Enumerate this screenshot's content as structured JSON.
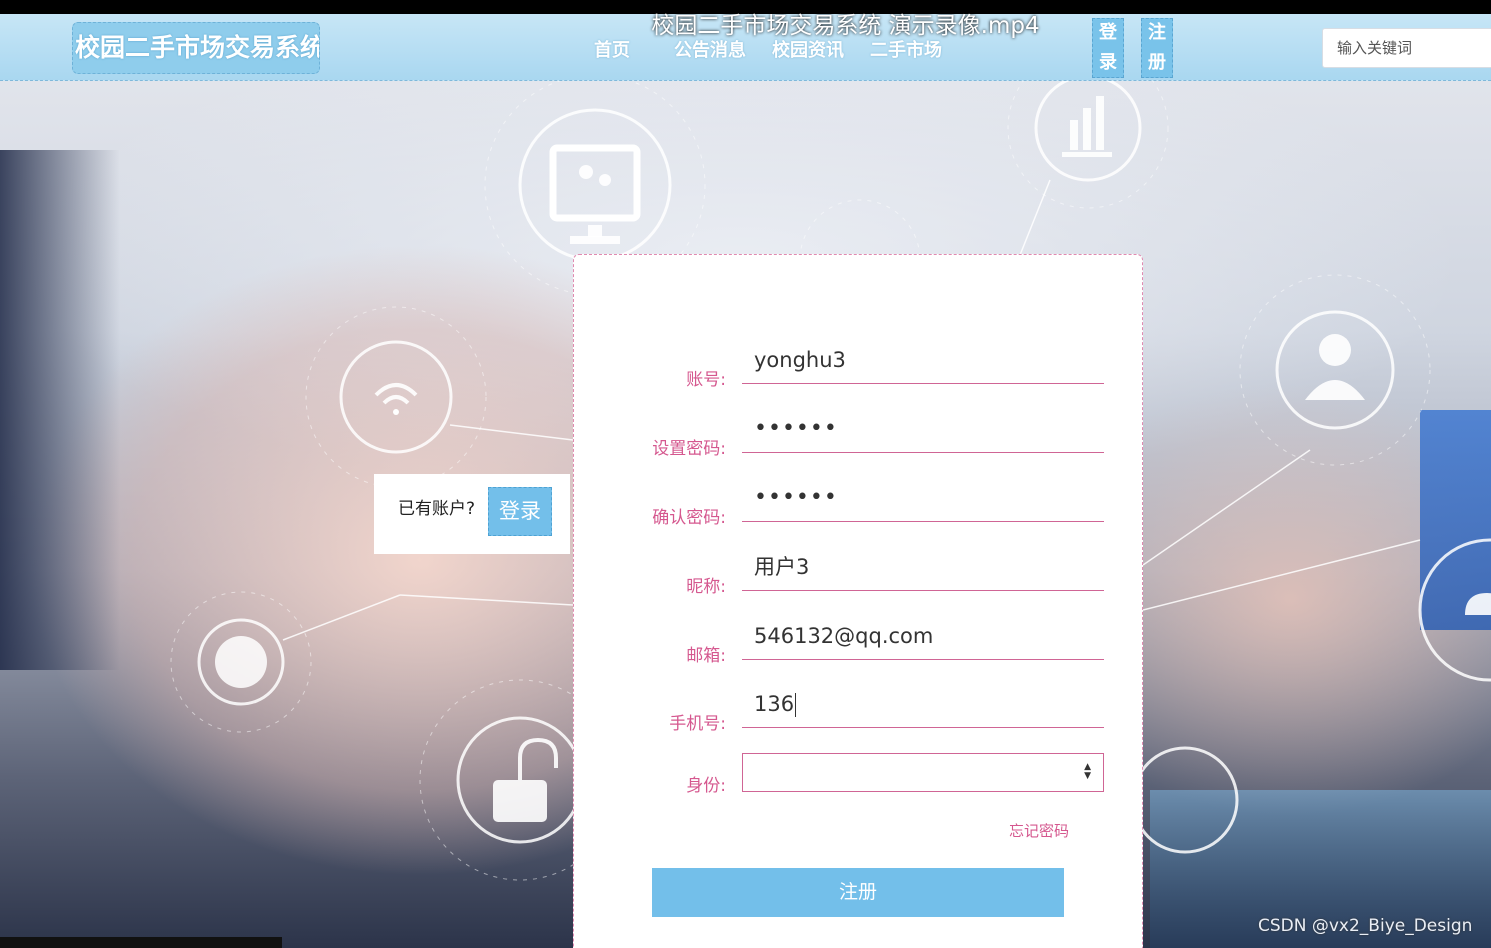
{
  "video_title": "校园二手市场交易系统 演示录像.mp4",
  "header": {
    "logo_text": "校园二手市场交易系统",
    "nav": [
      "首页",
      "公告消息",
      "校园资讯",
      "二手市场"
    ],
    "login_label_top": "登",
    "login_label_bottom": "录",
    "register_label_top": "注",
    "register_label_bottom": "册",
    "search_placeholder": "输入关键词"
  },
  "login_prompt": {
    "text": "已有账户?",
    "button": "登录"
  },
  "form": {
    "fields": [
      {
        "label": "账号:",
        "value": "yonghu3"
      },
      {
        "label": "设置密码:",
        "value": "••••••"
      },
      {
        "label": "确认密码:",
        "value": "••••••"
      },
      {
        "label": "昵称:",
        "value": "用户3"
      },
      {
        "label": "邮箱:",
        "value": "546132@qq.com"
      },
      {
        "label": "手机号:",
        "value": "136"
      }
    ],
    "identity_label": "身份:",
    "identity_value": "",
    "forgot_password": "忘记密码",
    "submit": "注册"
  },
  "watermark": "CSDN @vx2_Biye_Design",
  "colors": {
    "accent_blue": "#73bfea",
    "pink_label": "#d5588f",
    "navbar": "#a9d7f0"
  }
}
